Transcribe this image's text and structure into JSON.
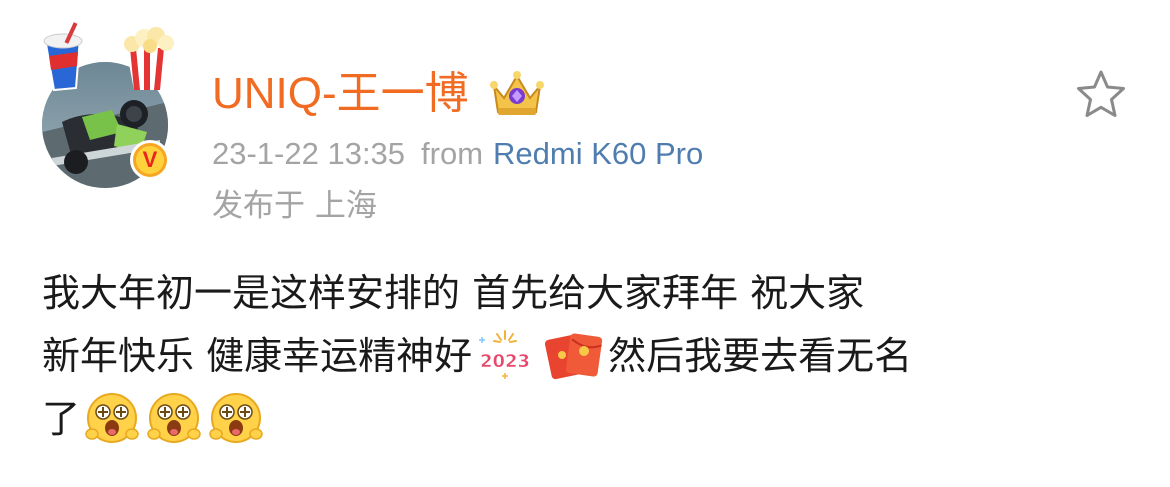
{
  "post": {
    "username": "UNIQ-王一博",
    "time": "23-1-22 13:35",
    "from_label": "from",
    "device": "Redmi K60 Pro",
    "location": "发布于 上海",
    "text": {
      "line1": "我大年初一是这样安排的 首先给大家拜年 祝大家",
      "line2_a": "新年快乐 健康幸运精神好",
      "line2_b": "然后我要去看无名",
      "line3": "了"
    },
    "emoji_2023_text": "2023",
    "verified_mark": "V"
  },
  "icons": {
    "star": "star-outline-icon",
    "crown": "crown-badge-icon",
    "verified": "verified-v-icon",
    "emoji_2023": "2023-fireworks-emoji",
    "emoji_hongbao": "red-envelope-emoji",
    "emoji_face": "excited-face-emoji"
  },
  "colors": {
    "username": "#f26b22",
    "meta": "#a4a4a4",
    "device": "#4f7db0",
    "body_text": "#1a1a1a",
    "star_outline": "#8a8a8a"
  }
}
